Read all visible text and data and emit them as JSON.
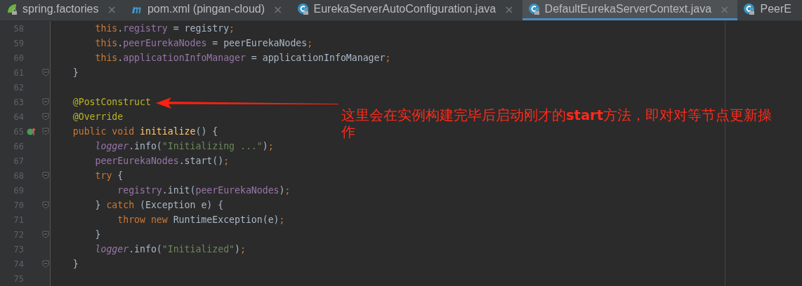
{
  "tabs": [
    {
      "label": "spring.factories",
      "kind": "spring",
      "locked": true,
      "selected": false,
      "close": "×"
    },
    {
      "label": "pom.xml (pingan-cloud)",
      "kind": "maven",
      "locked": false,
      "selected": false,
      "close": "×"
    },
    {
      "label": "EurekaServerAutoConfiguration.java",
      "kind": "class",
      "locked": true,
      "selected": false,
      "close": "×"
    },
    {
      "label": "DefaultEurekaServerContext.java",
      "kind": "class",
      "locked": true,
      "selected": true,
      "close": "×"
    },
    {
      "label": "PeerE",
      "kind": "class",
      "locked": true,
      "selected": false
    }
  ],
  "lines": [
    {
      "number": "58",
      "kind": "plain",
      "fold": false,
      "tokens": [
        {
          "text": "        this",
          "kind": "keyword"
        },
        {
          "text": ".",
          "kind": "plain"
        },
        {
          "text": "registry",
          "kind": "field"
        },
        {
          "text": " = registry",
          "kind": "plain"
        },
        {
          "text": ";",
          "kind": "keyword"
        }
      ]
    },
    {
      "number": "59",
      "kind": "plain",
      "fold": false,
      "tokens": [
        {
          "text": "        this",
          "kind": "keyword"
        },
        {
          "text": ".",
          "kind": "plain"
        },
        {
          "text": "peerEurekaNodes",
          "kind": "field"
        },
        {
          "text": " = peerEurekaNodes",
          "kind": "plain"
        },
        {
          "text": ";",
          "kind": "keyword"
        }
      ]
    },
    {
      "number": "60",
      "kind": "plain",
      "fold": false,
      "tokens": [
        {
          "text": "        this",
          "kind": "keyword"
        },
        {
          "text": ".",
          "kind": "plain"
        },
        {
          "text": "applicationInfoManager",
          "kind": "field"
        },
        {
          "text": " = applicationInfoManager",
          "kind": "plain"
        },
        {
          "text": ";",
          "kind": "keyword"
        }
      ]
    },
    {
      "number": "61",
      "kind": "plain",
      "fold": true,
      "tokens": [
        {
          "text": "    }",
          "kind": "plain"
        }
      ]
    },
    {
      "number": "62",
      "kind": "plain",
      "fold": false
    },
    {
      "number": "63",
      "kind": "plain",
      "fold": true,
      "tokens": [
        {
          "text": "    @PostConstruct",
          "kind": "annotation"
        }
      ]
    },
    {
      "number": "64",
      "kind": "plain",
      "fold": true,
      "tokens": [
        {
          "text": "    @Override",
          "kind": "annotation"
        }
      ]
    },
    {
      "number": "65",
      "kind": "implements",
      "fold": true,
      "tokens": [
        {
          "text": "    public void ",
          "kind": "keyword"
        },
        {
          "text": "initialize",
          "kind": "method"
        },
        {
          "text": "() {",
          "kind": "plain"
        }
      ]
    },
    {
      "number": "66",
      "kind": "plain",
      "fold": false,
      "tokens": [
        {
          "text": "        logger",
          "kind": "static"
        },
        {
          "text": ".info(",
          "kind": "plain"
        },
        {
          "text": "\"Initializing ...\"",
          "kind": "string"
        },
        {
          "text": ")",
          "kind": "plain"
        },
        {
          "text": ";",
          "kind": "keyword"
        }
      ]
    },
    {
      "number": "67",
      "kind": "plain",
      "fold": false,
      "tokens": [
        {
          "text": "        peerEurekaNodes",
          "kind": "field"
        },
        {
          "text": ".start()",
          "kind": "plain"
        },
        {
          "text": ";",
          "kind": "keyword"
        }
      ]
    },
    {
      "number": "68",
      "kind": "plain",
      "fold": true,
      "tokens": [
        {
          "text": "        try ",
          "kind": "keyword"
        },
        {
          "text": "{",
          "kind": "plain"
        }
      ]
    },
    {
      "number": "69",
      "kind": "plain",
      "fold": false,
      "tokens": [
        {
          "text": "            registry",
          "kind": "field"
        },
        {
          "text": ".init(",
          "kind": "plain"
        },
        {
          "text": "peerEurekaNodes",
          "kind": "field"
        },
        {
          "text": ")",
          "kind": "plain"
        },
        {
          "text": ";",
          "kind": "keyword"
        }
      ]
    },
    {
      "number": "70",
      "kind": "plain",
      "fold": true,
      "tokens": [
        {
          "text": "        } ",
          "kind": "plain"
        },
        {
          "text": "catch ",
          "kind": "keyword"
        },
        {
          "text": "(Exception e) {",
          "kind": "plain"
        }
      ]
    },
    {
      "number": "71",
      "kind": "plain",
      "fold": false,
      "tokens": [
        {
          "text": "            throw new ",
          "kind": "keyword"
        },
        {
          "text": "RuntimeException(e)",
          "kind": "plain"
        },
        {
          "text": ";",
          "kind": "keyword"
        }
      ]
    },
    {
      "number": "72",
      "kind": "plain",
      "fold": true,
      "tokens": [
        {
          "text": "        }",
          "kind": "plain"
        }
      ]
    },
    {
      "number": "73",
      "kind": "plain",
      "fold": false,
      "tokens": [
        {
          "text": "        logger",
          "kind": "static"
        },
        {
          "text": ".info(",
          "kind": "plain"
        },
        {
          "text": "\"Initialized\"",
          "kind": "string"
        },
        {
          "text": ")",
          "kind": "plain"
        },
        {
          "text": ";",
          "kind": "keyword"
        }
      ]
    },
    {
      "number": "74",
      "kind": "plain",
      "fold": true,
      "tokens": [
        {
          "text": "    }",
          "kind": "plain"
        }
      ]
    },
    {
      "number": "75",
      "kind": "plain",
      "fold": false
    }
  ],
  "note": {
    "text": "这里会在实例构建完毕后启动刚才的**start**方法，即对对等节点更新操作"
  }
}
